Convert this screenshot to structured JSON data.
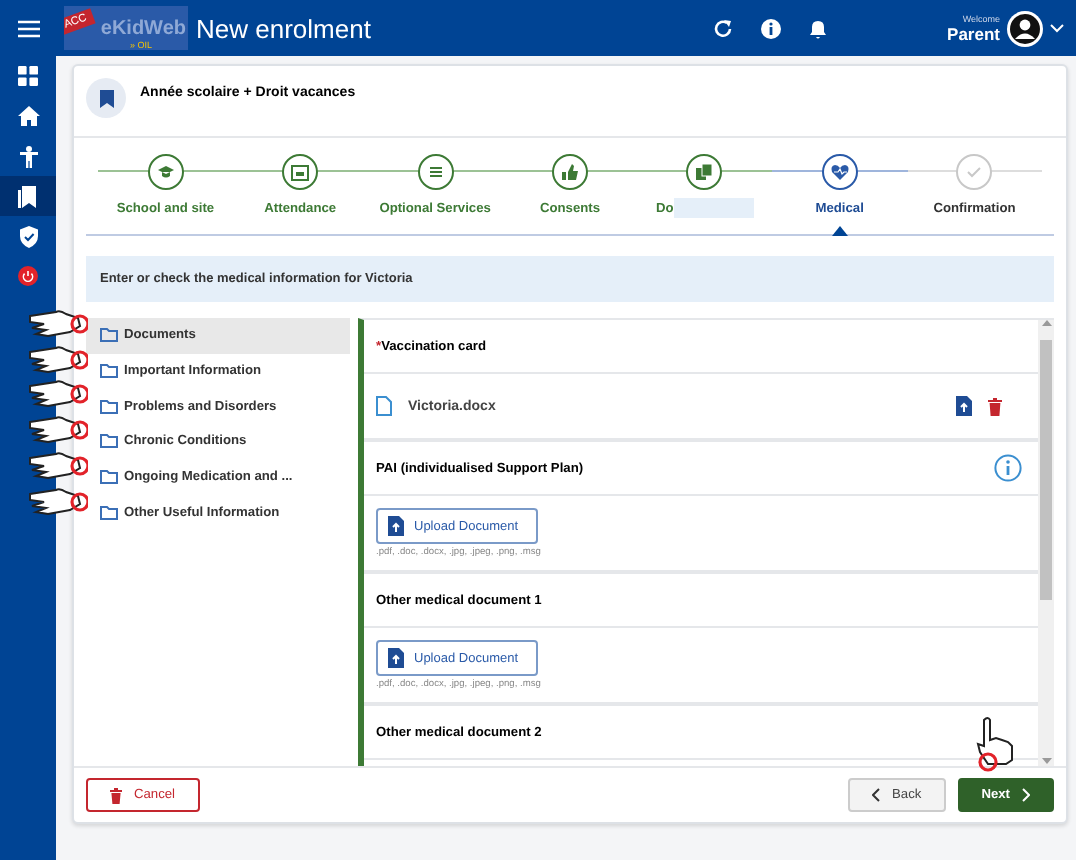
{
  "header": {
    "badge": "ACC",
    "brand": "eKidWeb",
    "brand_sub": "» OIL",
    "title": "New enrolment",
    "welcome": "Welcome",
    "user": "Parent"
  },
  "card": {
    "title": "Année scolaire + Droit vacances"
  },
  "steps": [
    {
      "label": "School and site",
      "completed": true,
      "selected": false
    },
    {
      "label": "Attendance",
      "completed": true,
      "selected": false
    },
    {
      "label": "Optional Services",
      "completed": true,
      "selected": false
    },
    {
      "label": "Consents",
      "completed": true,
      "selected": false
    },
    {
      "label": "Do",
      "completed": true,
      "selected": false,
      "redacted": true
    },
    {
      "label": "Medical",
      "completed": false,
      "selected": true
    },
    {
      "label": "Confirmation",
      "completed": false,
      "selected": false
    }
  ],
  "info": "Enter or check the medical information for Victoria",
  "menu": [
    {
      "label": "Documents",
      "selected": true
    },
    {
      "label": "Important Information",
      "selected": false
    },
    {
      "label": "Problems and Disorders",
      "selected": false
    },
    {
      "label": "Chronic Conditions",
      "selected": false
    },
    {
      "label": "Ongoing Medication and ...",
      "selected": false
    },
    {
      "label": "Other Useful Information",
      "selected": false
    }
  ],
  "sections": [
    {
      "title": "Vaccination card",
      "required_mark": "*",
      "body": {
        "kind": "file",
        "filename": "Victoria.docx"
      }
    },
    {
      "title": "PAI (individualised Support Plan)",
      "info": true,
      "body": {
        "kind": "upload",
        "button": "Upload Document",
        "formats": ".pdf, .doc, .docx, .jpg, .jpeg, .png, .msg"
      }
    },
    {
      "title": "Other medical document 1",
      "body": {
        "kind": "upload",
        "button": "Upload Document",
        "formats": ".pdf, .doc, .docx, .jpg, .jpeg, .png, .msg"
      }
    },
    {
      "title": "Other medical document 2"
    }
  ],
  "footer": {
    "cancel": "Cancel",
    "back": "Back",
    "next": "Next"
  }
}
